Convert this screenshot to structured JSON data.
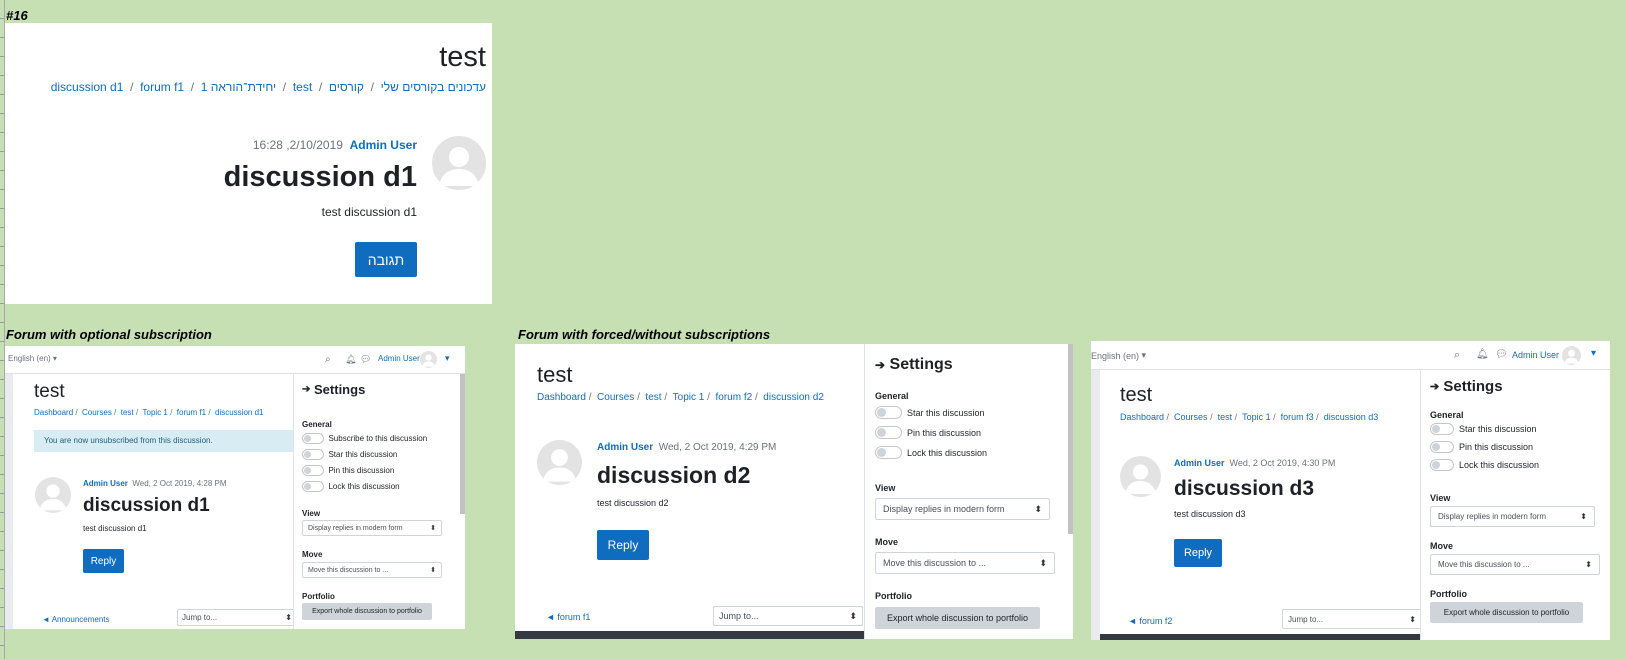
{
  "top": {
    "number_label": "#16",
    "page_title": "test",
    "breadcrumb": [
      "עדכונים בקורסים שלי",
      "קורסים",
      "test",
      "יחידת־הוראה 1",
      "forum f1",
      "discussion d1"
    ],
    "author": "Admin User",
    "date": "16:28 ,2/10/2019",
    "discussion_title": "discussion d1",
    "message": "test discussion d1",
    "reply_label": "תגובה"
  },
  "captions": {
    "optional": "Forum with optional subscription",
    "forced": "Forum with forced/without subscriptions"
  },
  "optional": {
    "language": "English (en)",
    "user": "Admin User",
    "page_title": "test",
    "breadcrumb": [
      "Dashboard",
      "Courses",
      "test",
      "Topic 1",
      "forum f1",
      "discussion d1"
    ],
    "alert": "You are now unsubscribed from this discussion.",
    "author": "Admin User",
    "date": "Wed, 2 Oct 2019, 4:28 PM",
    "discussion_title": "discussion d1",
    "message": "test discussion d1",
    "reply_label": "Reply",
    "prev_link": "◄ Announcements",
    "jump_placeholder": "Jump to...",
    "settings": {
      "title": "Settings",
      "general_label": "General",
      "toggles": [
        "Subscribe to this discussion",
        "Star this discussion",
        "Pin this discussion",
        "Lock this discussion"
      ],
      "view_label": "View",
      "view_value": "Display replies in modern form",
      "move_label": "Move",
      "move_value": "Move this discussion to ...",
      "portfolio_label": "Portfolio",
      "export_label": "Export whole discussion to portfolio"
    }
  },
  "forced": {
    "page_title": "test",
    "breadcrumb": [
      "Dashboard",
      "Courses",
      "test",
      "Topic 1",
      "forum f2",
      "discussion d2"
    ],
    "author": "Admin User",
    "date": "Wed, 2 Oct 2019, 4:29 PM",
    "discussion_title": "discussion d2",
    "message": "test discussion d2",
    "reply_label": "Reply",
    "prev_link": "◄ forum f1",
    "jump_placeholder": "Jump to...",
    "settings": {
      "title": "Settings",
      "general_label": "General",
      "toggles": [
        "Star this discussion",
        "Pin this discussion",
        "Lock this discussion"
      ],
      "view_label": "View",
      "view_value": "Display replies in modern form",
      "move_label": "Move",
      "move_value": "Move this discussion to ...",
      "portfolio_label": "Portfolio",
      "export_label": "Export whole discussion to portfolio"
    }
  },
  "third": {
    "language": "English (en)",
    "user": "Admin User",
    "page_title": "test",
    "breadcrumb": [
      "Dashboard",
      "Courses",
      "test",
      "Topic 1",
      "forum f3",
      "discussion d3"
    ],
    "author": "Admin User",
    "date": "Wed, 2 Oct 2019, 4:30 PM",
    "discussion_title": "discussion d3",
    "message": "test discussion d3",
    "reply_label": "Reply",
    "prev_link": "◄ forum f2",
    "jump_placeholder": "Jump to...",
    "settings": {
      "title": "Settings",
      "general_label": "General",
      "toggles": [
        "Star this discussion",
        "Pin this discussion",
        "Lock this discussion"
      ],
      "view_label": "View",
      "view_value": "Display replies in modern form",
      "move_label": "Move",
      "move_value": "Move this discussion to ...",
      "portfolio_label": "Portfolio",
      "export_label": "Export whole discussion to portfolio"
    }
  }
}
